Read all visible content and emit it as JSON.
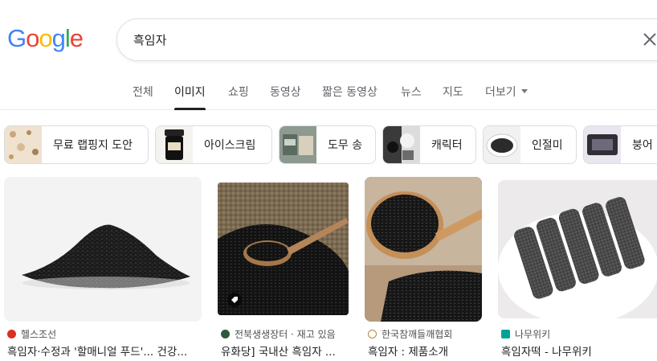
{
  "logo": {
    "letters": [
      "G",
      "o",
      "o",
      "g",
      "l",
      "e"
    ],
    "colors": [
      "#4285F4",
      "#EA4335",
      "#FBBC05",
      "#4285F4",
      "#34A853",
      "#EA4335"
    ]
  },
  "search": {
    "query": "흑임자"
  },
  "tabs": [
    "전체",
    "이미지",
    "쇼핑",
    "동영상",
    "짧은 동영상",
    "뉴스",
    "지도",
    "더보기"
  ],
  "chips": [
    "무료 랩핑지 도안",
    "아이스크림",
    "도무 송",
    "캐릭터",
    "인절미",
    "붕어"
  ],
  "results": [
    {
      "source": "헬스조선",
      "title": "흑임자·수정과 '할매니얼 푸드'... 건강..."
    },
    {
      "source": "전북생생장터 · 재고 있음",
      "title": "유화당] 국내산 흑임자 ..."
    },
    {
      "source": "한국참깨들깨협회",
      "title": "흑임자 : 제품소개"
    },
    {
      "source": "나무위키",
      "title": "흑임자떡 - 나무위키"
    }
  ],
  "colors": {
    "accent": "#1a73e8",
    "favicon_healthchosun": "#d93025",
    "favicon_jeonbuk": "#2e5a3a",
    "favicon_namuwiki": "#00a495"
  }
}
